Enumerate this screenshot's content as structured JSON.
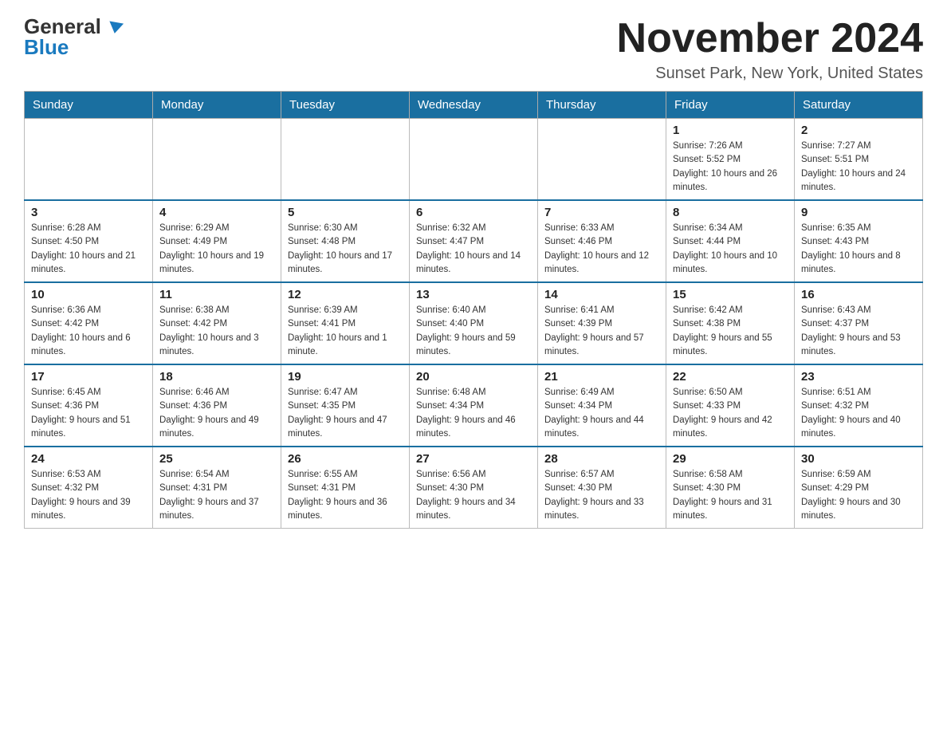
{
  "header": {
    "logo_general": "General",
    "logo_blue": "Blue",
    "month_title": "November 2024",
    "location": "Sunset Park, New York, United States"
  },
  "days_of_week": [
    "Sunday",
    "Monday",
    "Tuesday",
    "Wednesday",
    "Thursday",
    "Friday",
    "Saturday"
  ],
  "weeks": [
    [
      {
        "day": "",
        "sunrise": "",
        "sunset": "",
        "daylight": ""
      },
      {
        "day": "",
        "sunrise": "",
        "sunset": "",
        "daylight": ""
      },
      {
        "day": "",
        "sunrise": "",
        "sunset": "",
        "daylight": ""
      },
      {
        "day": "",
        "sunrise": "",
        "sunset": "",
        "daylight": ""
      },
      {
        "day": "",
        "sunrise": "",
        "sunset": "",
        "daylight": ""
      },
      {
        "day": "1",
        "sunrise": "Sunrise: 7:26 AM",
        "sunset": "Sunset: 5:52 PM",
        "daylight": "Daylight: 10 hours and 26 minutes."
      },
      {
        "day": "2",
        "sunrise": "Sunrise: 7:27 AM",
        "sunset": "Sunset: 5:51 PM",
        "daylight": "Daylight: 10 hours and 24 minutes."
      }
    ],
    [
      {
        "day": "3",
        "sunrise": "Sunrise: 6:28 AM",
        "sunset": "Sunset: 4:50 PM",
        "daylight": "Daylight: 10 hours and 21 minutes."
      },
      {
        "day": "4",
        "sunrise": "Sunrise: 6:29 AM",
        "sunset": "Sunset: 4:49 PM",
        "daylight": "Daylight: 10 hours and 19 minutes."
      },
      {
        "day": "5",
        "sunrise": "Sunrise: 6:30 AM",
        "sunset": "Sunset: 4:48 PM",
        "daylight": "Daylight: 10 hours and 17 minutes."
      },
      {
        "day": "6",
        "sunrise": "Sunrise: 6:32 AM",
        "sunset": "Sunset: 4:47 PM",
        "daylight": "Daylight: 10 hours and 14 minutes."
      },
      {
        "day": "7",
        "sunrise": "Sunrise: 6:33 AM",
        "sunset": "Sunset: 4:46 PM",
        "daylight": "Daylight: 10 hours and 12 minutes."
      },
      {
        "day": "8",
        "sunrise": "Sunrise: 6:34 AM",
        "sunset": "Sunset: 4:44 PM",
        "daylight": "Daylight: 10 hours and 10 minutes."
      },
      {
        "day": "9",
        "sunrise": "Sunrise: 6:35 AM",
        "sunset": "Sunset: 4:43 PM",
        "daylight": "Daylight: 10 hours and 8 minutes."
      }
    ],
    [
      {
        "day": "10",
        "sunrise": "Sunrise: 6:36 AM",
        "sunset": "Sunset: 4:42 PM",
        "daylight": "Daylight: 10 hours and 6 minutes."
      },
      {
        "day": "11",
        "sunrise": "Sunrise: 6:38 AM",
        "sunset": "Sunset: 4:42 PM",
        "daylight": "Daylight: 10 hours and 3 minutes."
      },
      {
        "day": "12",
        "sunrise": "Sunrise: 6:39 AM",
        "sunset": "Sunset: 4:41 PM",
        "daylight": "Daylight: 10 hours and 1 minute."
      },
      {
        "day": "13",
        "sunrise": "Sunrise: 6:40 AM",
        "sunset": "Sunset: 4:40 PM",
        "daylight": "Daylight: 9 hours and 59 minutes."
      },
      {
        "day": "14",
        "sunrise": "Sunrise: 6:41 AM",
        "sunset": "Sunset: 4:39 PM",
        "daylight": "Daylight: 9 hours and 57 minutes."
      },
      {
        "day": "15",
        "sunrise": "Sunrise: 6:42 AM",
        "sunset": "Sunset: 4:38 PM",
        "daylight": "Daylight: 9 hours and 55 minutes."
      },
      {
        "day": "16",
        "sunrise": "Sunrise: 6:43 AM",
        "sunset": "Sunset: 4:37 PM",
        "daylight": "Daylight: 9 hours and 53 minutes."
      }
    ],
    [
      {
        "day": "17",
        "sunrise": "Sunrise: 6:45 AM",
        "sunset": "Sunset: 4:36 PM",
        "daylight": "Daylight: 9 hours and 51 minutes."
      },
      {
        "day": "18",
        "sunrise": "Sunrise: 6:46 AM",
        "sunset": "Sunset: 4:36 PM",
        "daylight": "Daylight: 9 hours and 49 minutes."
      },
      {
        "day": "19",
        "sunrise": "Sunrise: 6:47 AM",
        "sunset": "Sunset: 4:35 PM",
        "daylight": "Daylight: 9 hours and 47 minutes."
      },
      {
        "day": "20",
        "sunrise": "Sunrise: 6:48 AM",
        "sunset": "Sunset: 4:34 PM",
        "daylight": "Daylight: 9 hours and 46 minutes."
      },
      {
        "day": "21",
        "sunrise": "Sunrise: 6:49 AM",
        "sunset": "Sunset: 4:34 PM",
        "daylight": "Daylight: 9 hours and 44 minutes."
      },
      {
        "day": "22",
        "sunrise": "Sunrise: 6:50 AM",
        "sunset": "Sunset: 4:33 PM",
        "daylight": "Daylight: 9 hours and 42 minutes."
      },
      {
        "day": "23",
        "sunrise": "Sunrise: 6:51 AM",
        "sunset": "Sunset: 4:32 PM",
        "daylight": "Daylight: 9 hours and 40 minutes."
      }
    ],
    [
      {
        "day": "24",
        "sunrise": "Sunrise: 6:53 AM",
        "sunset": "Sunset: 4:32 PM",
        "daylight": "Daylight: 9 hours and 39 minutes."
      },
      {
        "day": "25",
        "sunrise": "Sunrise: 6:54 AM",
        "sunset": "Sunset: 4:31 PM",
        "daylight": "Daylight: 9 hours and 37 minutes."
      },
      {
        "day": "26",
        "sunrise": "Sunrise: 6:55 AM",
        "sunset": "Sunset: 4:31 PM",
        "daylight": "Daylight: 9 hours and 36 minutes."
      },
      {
        "day": "27",
        "sunrise": "Sunrise: 6:56 AM",
        "sunset": "Sunset: 4:30 PM",
        "daylight": "Daylight: 9 hours and 34 minutes."
      },
      {
        "day": "28",
        "sunrise": "Sunrise: 6:57 AM",
        "sunset": "Sunset: 4:30 PM",
        "daylight": "Daylight: 9 hours and 33 minutes."
      },
      {
        "day": "29",
        "sunrise": "Sunrise: 6:58 AM",
        "sunset": "Sunset: 4:30 PM",
        "daylight": "Daylight: 9 hours and 31 minutes."
      },
      {
        "day": "30",
        "sunrise": "Sunrise: 6:59 AM",
        "sunset": "Sunset: 4:29 PM",
        "daylight": "Daylight: 9 hours and 30 minutes."
      }
    ]
  ]
}
